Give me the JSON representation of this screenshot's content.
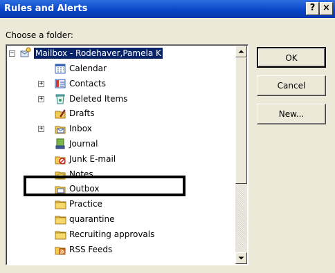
{
  "window": {
    "title": "Rules and Alerts",
    "help_glyph": "?",
    "close_glyph": "×"
  },
  "prompt": "Choose a folder:",
  "tree": {
    "expander_collapsed": "+",
    "expander_expanded": "−",
    "root_label": "Mailbox - Rodehaver,Pamela K",
    "items": [
      {
        "label": "Calendar",
        "icon": "calendar-icon"
      },
      {
        "label": "Contacts",
        "icon": "contacts-icon",
        "expandable": true
      },
      {
        "label": "Deleted Items",
        "icon": "deleted-items-icon",
        "expandable": true
      },
      {
        "label": "Drafts",
        "icon": "drafts-icon"
      },
      {
        "label": "Inbox",
        "icon": "inbox-icon",
        "expandable": true
      },
      {
        "label": "Journal",
        "icon": "journal-icon"
      },
      {
        "label": "Junk E-mail",
        "icon": "junk-email-icon"
      },
      {
        "label": "Notes",
        "icon": "notes-icon"
      },
      {
        "label": "Outbox",
        "icon": "outbox-icon"
      },
      {
        "label": "Practice",
        "icon": "folder-icon"
      },
      {
        "label": "quarantine",
        "icon": "folder-icon"
      },
      {
        "label": "Recruiting approvals",
        "icon": "folder-icon"
      },
      {
        "label": "RSS Feeds",
        "icon": "rss-feeds-icon"
      }
    ]
  },
  "buttons": {
    "ok": "OK",
    "cancel": "Cancel",
    "new": "New..."
  },
  "colors": {
    "titlebar": "#0a46c8",
    "selection": "#0a246a",
    "dialog_bg": "#ece9d8",
    "folder_yellow": "#f3c951"
  }
}
